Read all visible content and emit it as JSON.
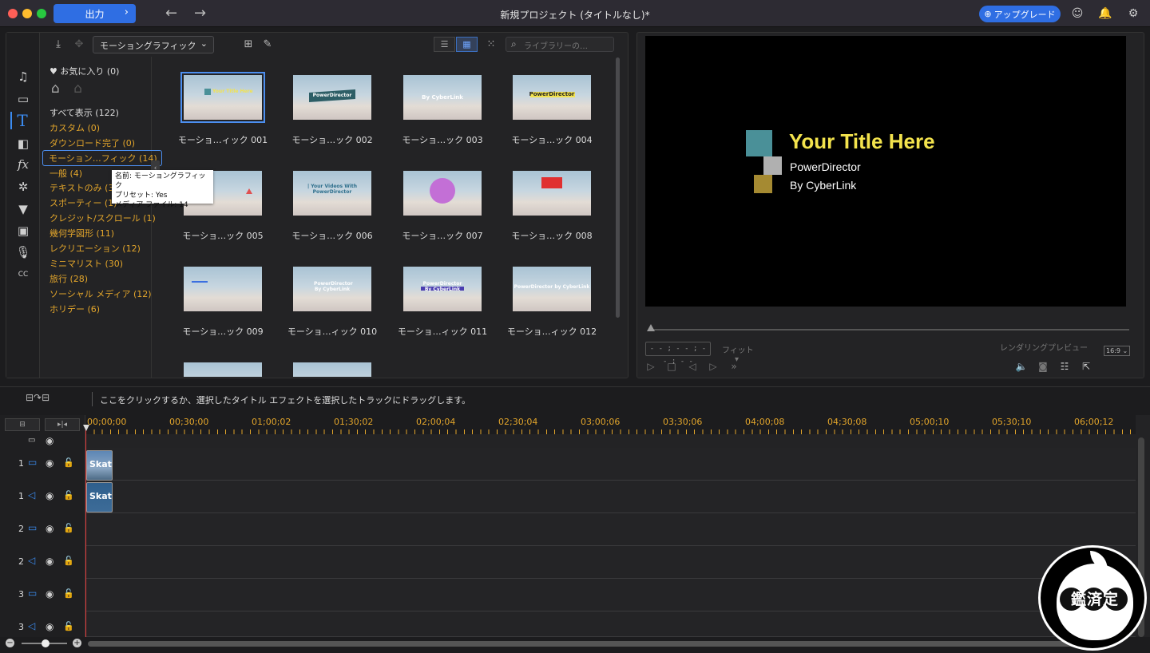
{
  "titlebar": {
    "export_label": "出力",
    "window_title": "新規プロジェクト (タイトルなし)*",
    "upgrade_label": "アップグレード"
  },
  "library": {
    "category_dropdown": "モーショングラフィック",
    "search_placeholder": "ライブラリーの…",
    "favorites": "お気に入り (0)",
    "categories": [
      {
        "label": "すべて表示 (122)"
      },
      {
        "label": "カスタム (0)"
      },
      {
        "label": "ダウンロード完了 (0)"
      },
      {
        "label": "モーション…フィック (14)"
      },
      {
        "label": "一般 (4)"
      },
      {
        "label": "テキストのみ (3)"
      },
      {
        "label": "スポーティー (1)"
      },
      {
        "label": "クレジット/スクロール (1)"
      },
      {
        "label": "幾何学図形 (11)"
      },
      {
        "label": "レクリエーション (12)"
      },
      {
        "label": "ミニマリスト (30)"
      },
      {
        "label": "旅行 (28)"
      },
      {
        "label": "ソーシャル メディア (12)"
      },
      {
        "label": "ホリデー (6)"
      }
    ],
    "tooltip": {
      "line1": "名前: モーショングラフィック",
      "line2": "プリセット: Yes",
      "line3": "メディア ファイル: 14"
    },
    "thumbnails": [
      {
        "label": "モーショ…ィック 001",
        "text": "Your Title Here"
      },
      {
        "label": "モーショ…ック 002",
        "text": "PowerDirector"
      },
      {
        "label": "モーショ…ック 003",
        "text": "By CyberLink"
      },
      {
        "label": "モーショ…ック 004",
        "text": "PowerDirector"
      },
      {
        "label": "モーショ…ック 005",
        "text": ""
      },
      {
        "label": "モーショ…ック 006",
        "text": "| Your Videos With PowerDirector"
      },
      {
        "label": "モーショ…ック 007",
        "text": ""
      },
      {
        "label": "モーショ…ック 008",
        "text": ""
      },
      {
        "label": "モーショ…ック 009",
        "text": ""
      },
      {
        "label": "モーショ…ィック 010",
        "text": "PowerDirector By CyberLink"
      },
      {
        "label": "モーショ…ィック 011",
        "text": "PowerDirector By CyberLink"
      },
      {
        "label": "モーショ…ィック 012",
        "text": "PowerDirector by CyberLink"
      }
    ]
  },
  "preview": {
    "title": "Your Title Here",
    "line1": "PowerDirector",
    "line2": "By CyberLink",
    "timecode": "- - ; - - ; - - ; - -",
    "fit_label": "フィット",
    "render_label": "レンダリングプレビュー",
    "aspect_ratio": "16:9",
    "title_color": "#f3e34d"
  },
  "hint": {
    "text": "ここをクリックするか、選択したタイトル エフェクトを選択したトラックにドラッグします。"
  },
  "timeline": {
    "ticks": [
      "00;00;00",
      "00;30;00",
      "01;00;02",
      "01;30;02",
      "02;00;04",
      "02;30;04",
      "03;00;06",
      "03;30;06",
      "04;00;08",
      "04;30;08",
      "05;00;10",
      "05;30;10",
      "06;00;12"
    ],
    "tracks": [
      {
        "num": "1",
        "type": "video"
      },
      {
        "num": "1",
        "type": "audio"
      },
      {
        "num": "2",
        "type": "video"
      },
      {
        "num": "2",
        "type": "audio"
      },
      {
        "num": "3",
        "type": "video"
      },
      {
        "num": "3",
        "type": "audio"
      }
    ],
    "clip_label": "Skate"
  },
  "badge": {
    "text": "鑑済定"
  }
}
